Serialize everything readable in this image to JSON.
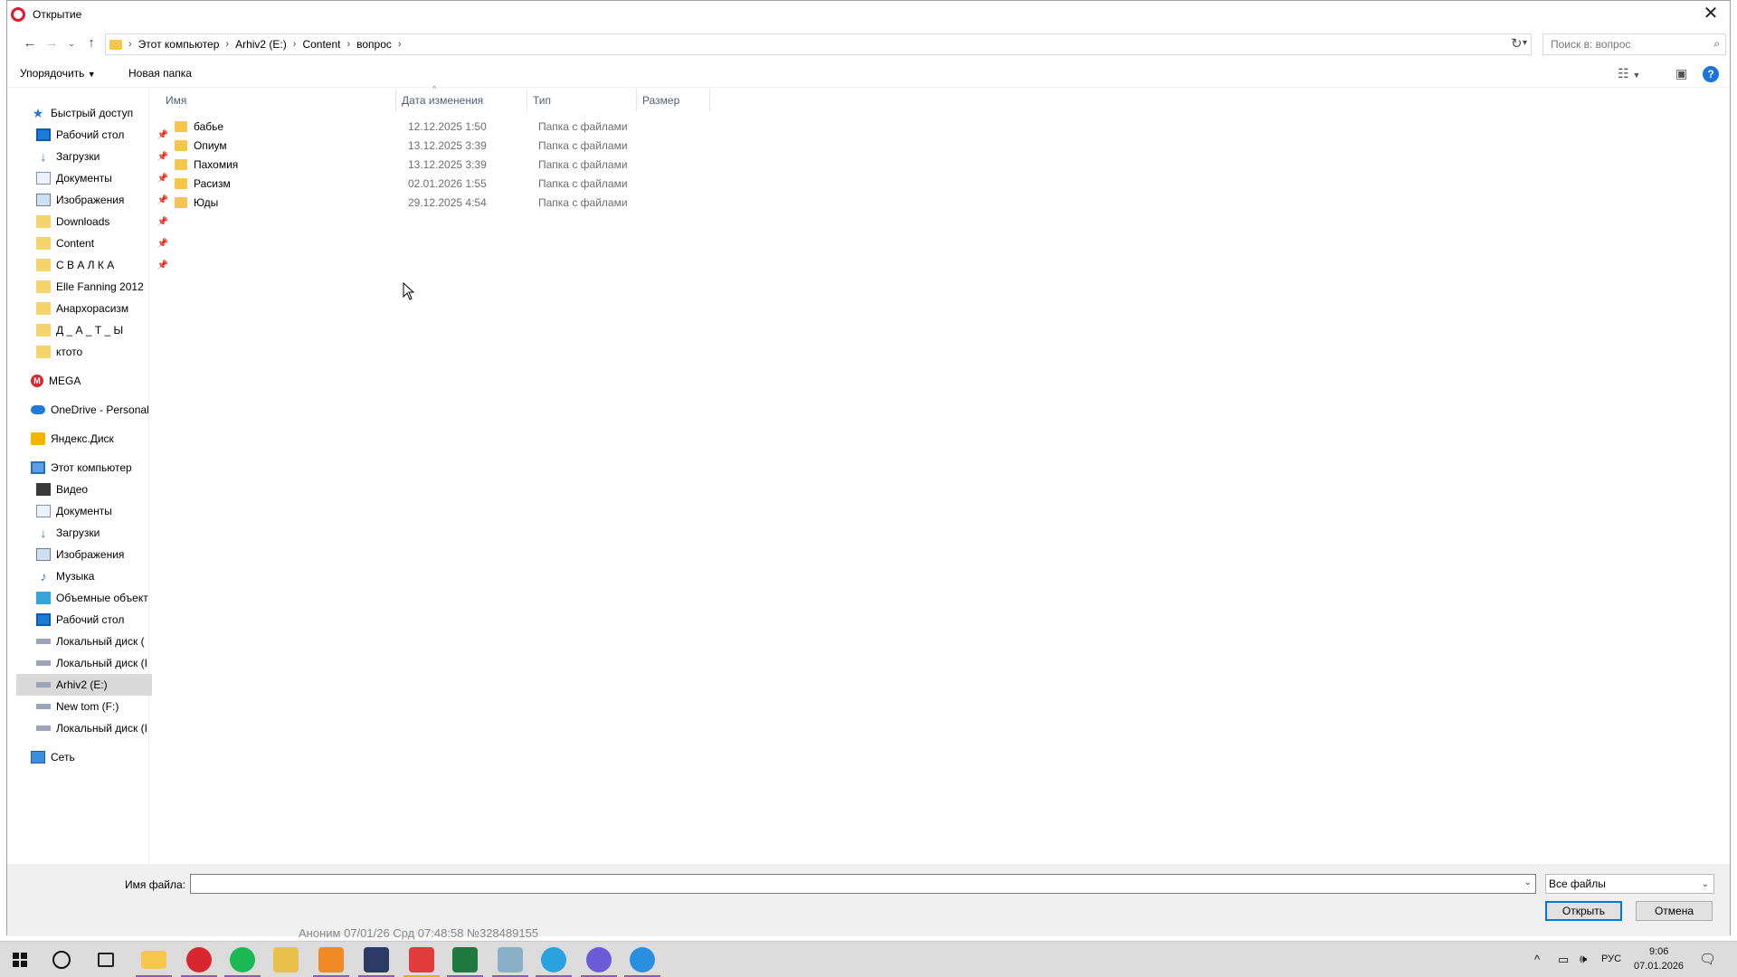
{
  "window": {
    "title": "Открытие"
  },
  "address": {
    "crumbs": [
      "Этот компьютер",
      "Arhiv2 (E:)",
      "Content",
      "вопрос"
    ],
    "search_placeholder": "Поиск в: вопрос"
  },
  "toolbar": {
    "organize_label": "Упорядочить",
    "new_folder_label": "Новая папка"
  },
  "sidebar": {
    "quick_access": "Быстрый доступ",
    "quick_items": [
      {
        "label": "Рабочий стол",
        "icon": "desktop-icon"
      },
      {
        "label": "Загрузки",
        "icon": "downloads-icon"
      },
      {
        "label": "Документы",
        "icon": "documents-icon"
      },
      {
        "label": "Изображения",
        "icon": "pictures-icon"
      },
      {
        "label": "Downloads",
        "icon": "folder-icon"
      },
      {
        "label": "Content",
        "icon": "folder-icon"
      },
      {
        "label": "С В А Л К А",
        "icon": "folder-icon"
      },
      {
        "label": "Elle Fanning 2012",
        "icon": "folder-icon"
      },
      {
        "label": "Анархорасизм",
        "icon": "folder-icon"
      },
      {
        "label": "Д _ А _ Т _ Ы",
        "icon": "folder-icon"
      },
      {
        "label": "ктото",
        "icon": "folder-icon"
      }
    ],
    "mega": "MEGA",
    "onedrive": "OneDrive - Personal",
    "yandex": "Яндекс.Диск",
    "this_pc": "Этот компьютер",
    "pc_items": [
      {
        "label": "Видео",
        "icon": "videos-icon"
      },
      {
        "label": "Документы",
        "icon": "documents-icon"
      },
      {
        "label": "Загрузки",
        "icon": "downloads-icon"
      },
      {
        "label": "Изображения",
        "icon": "pictures-icon"
      },
      {
        "label": "Музыка",
        "icon": "music-icon"
      },
      {
        "label": "Объемные объект",
        "icon": "3d-objects-icon"
      },
      {
        "label": "Рабочий стол",
        "icon": "desktop-icon"
      },
      {
        "label": "Локальный диск (",
        "icon": "drive-icon"
      },
      {
        "label": "Локальный диск (I",
        "icon": "drive-icon"
      },
      {
        "label": "Arhiv2 (E:)",
        "icon": "drive-icon"
      },
      {
        "label": "New tom (F:)",
        "icon": "drive-icon"
      },
      {
        "label": "Локальный диск (I",
        "icon": "drive-icon"
      }
    ],
    "network": "Сеть"
  },
  "columns": {
    "name": "Имя",
    "date": "Дата изменения",
    "type": "Тип",
    "size": "Размер"
  },
  "files": [
    {
      "name": "бабье",
      "date": "12.12.2025 1:50",
      "type": "Папка с файлами"
    },
    {
      "name": "Опиум",
      "date": "13.12.2025 3:39",
      "type": "Папка с файлами"
    },
    {
      "name": "Пахомия",
      "date": "13.12.2025 3:39",
      "type": "Папка с файлами"
    },
    {
      "name": "Расизм",
      "date": "02.01.2026 1:55",
      "type": "Папка с файлами"
    },
    {
      "name": "Юды",
      "date": "29.12.2025 4:54",
      "type": "Папка с файлами"
    }
  ],
  "bottom": {
    "filename_label": "Имя файла:",
    "filename_value": "",
    "filter_value": "Все файлы",
    "open_label": "Открыть",
    "cancel_label": "Отмена"
  },
  "behind_window_text": "Аноним 07/01/26 Срд 07:48:58 №328489155",
  "taskbar": {
    "lang": "РУС",
    "time": "9:06",
    "date": "07.01.2026"
  },
  "colors": {
    "accent": "#0078d7",
    "folder": "#f5c84c",
    "opera": "#e0162b"
  }
}
